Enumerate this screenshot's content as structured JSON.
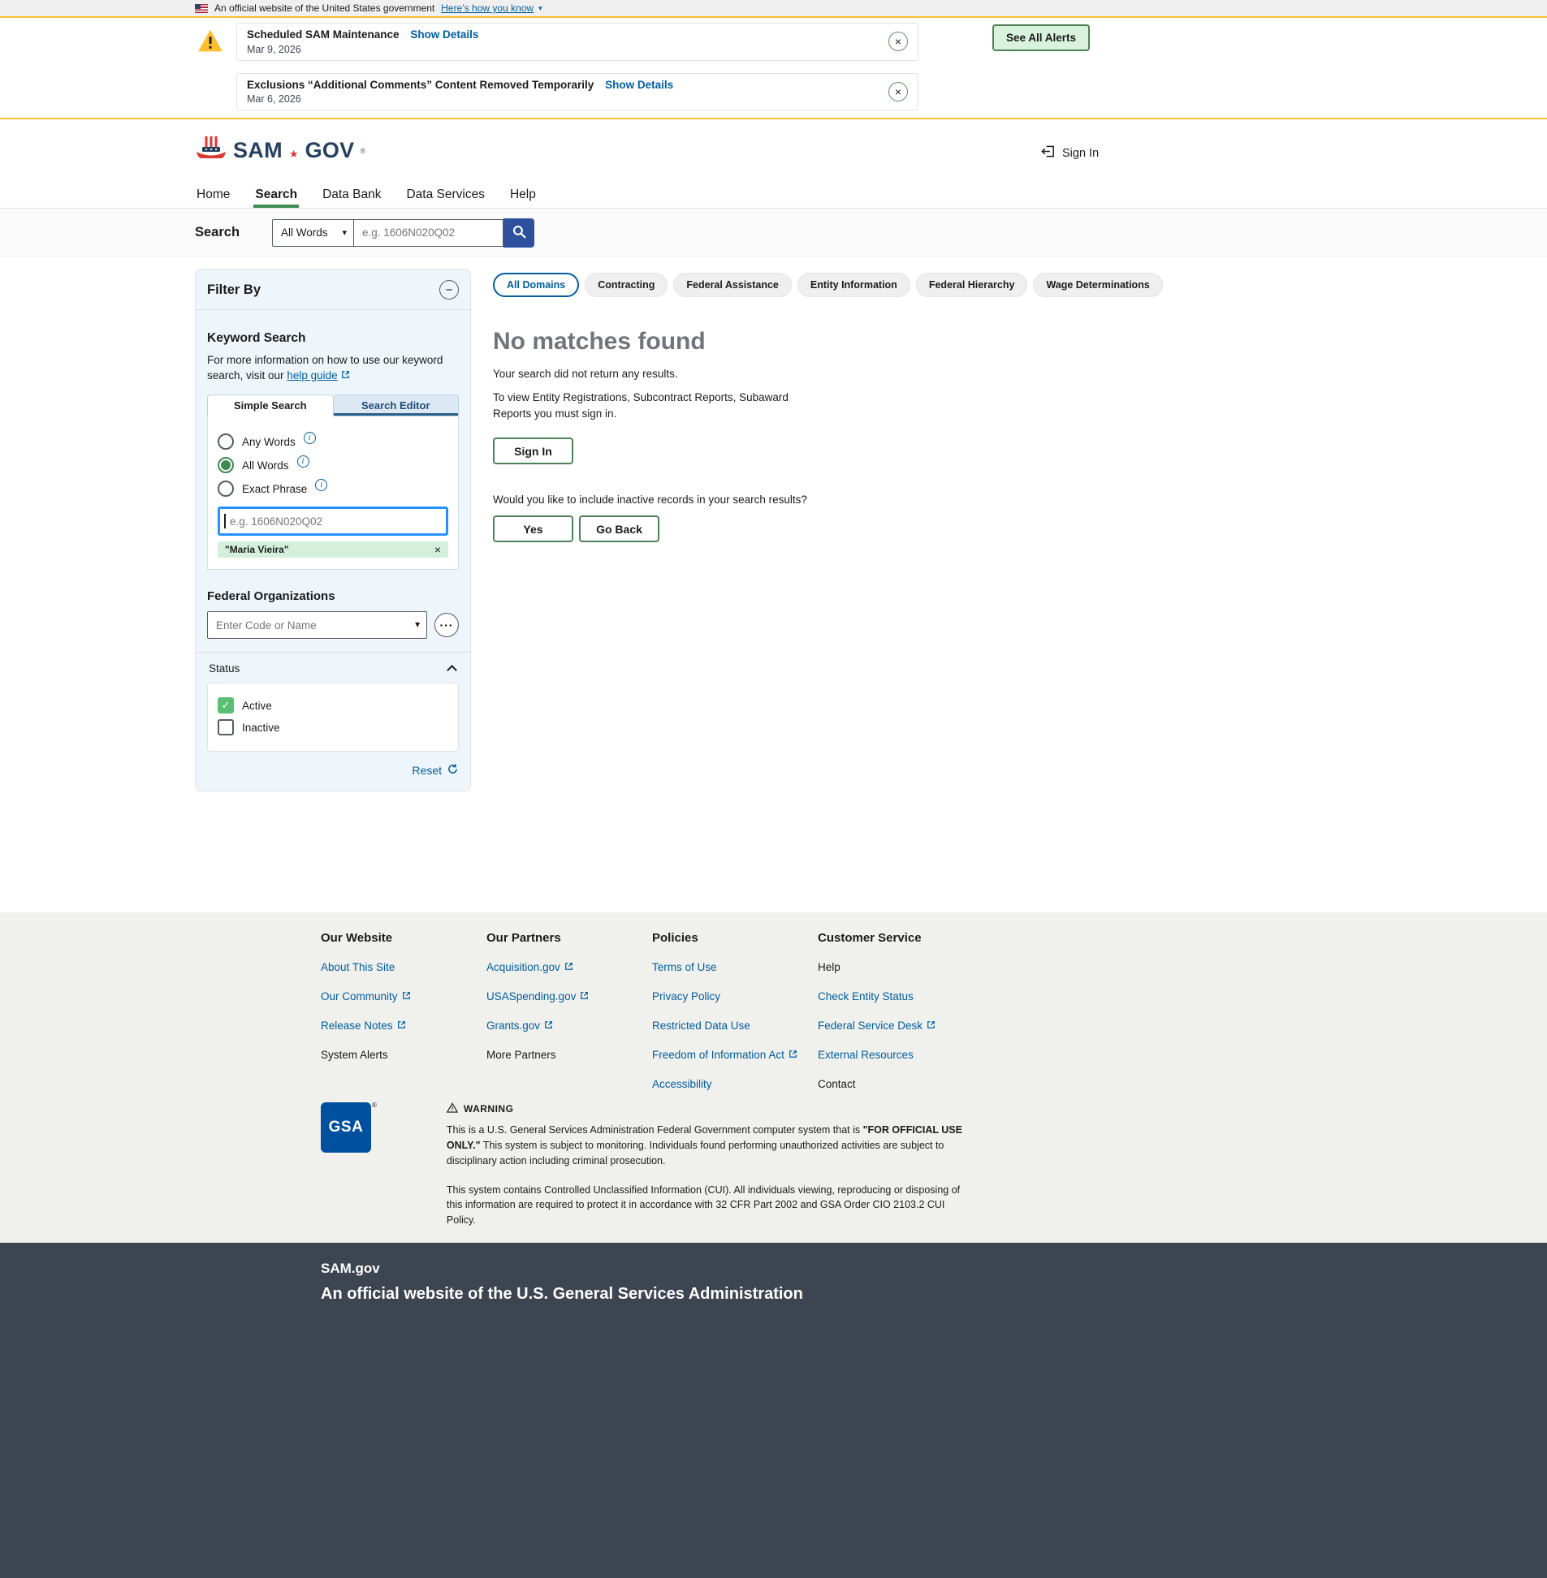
{
  "colors": {
    "accent_green": "#4d8055",
    "link_blue": "#005ea2",
    "search_button_blue": "#2e509f",
    "warning_yellow": "#ffbe2e",
    "focus_blue": "#2491ff",
    "dark_footer_bg": "#3d4551"
  },
  "icons": {
    "close": "×",
    "minus": "−",
    "ellipsis": "···",
    "caret_down": "▾",
    "check": "✓",
    "info": "i",
    "star": "★",
    "reg": "®"
  },
  "gov_banner": {
    "text": "An official website of the United States government",
    "link": "Here’s how you know"
  },
  "alerts": {
    "see_all_label": "See All Alerts",
    "items": [
      {
        "title": "Scheduled SAM Maintenance",
        "details_link": "Show Details",
        "date": "Mar 9, 2026"
      },
      {
        "title": "Exclusions “Additional Comments” Content Removed Temporarily",
        "details_link": "Show Details",
        "date": "Mar 6, 2026"
      }
    ]
  },
  "header": {
    "logo_sam": "SAM",
    "logo_gov": "GOV",
    "sign_in_label": "Sign In",
    "nav": [
      {
        "label": "Home"
      },
      {
        "label": "Search",
        "active": true
      },
      {
        "label": "Data Bank"
      },
      {
        "label": "Data Services"
      },
      {
        "label": "Help"
      }
    ]
  },
  "search_bar": {
    "label": "Search",
    "mode_selected": "All Words",
    "placeholder": "e.g. 1606N020Q02"
  },
  "filter": {
    "title": "Filter By",
    "keyword": {
      "heading": "Keyword Search",
      "help_text": "For more information on how to use our keyword search, visit our",
      "help_link": "help guide",
      "tabs": [
        "Simple Search",
        "Search Editor"
      ],
      "options": [
        "Any Words",
        "All Words",
        "Exact Phrase"
      ],
      "selected_option": "All Words",
      "input_placeholder": "e.g. 1606N020Q02",
      "chip": "\"Maria Vieira\""
    },
    "federal_orgs": {
      "heading": "Federal Organizations",
      "placeholder": "Enter Code or Name"
    },
    "status": {
      "heading": "Status",
      "options": [
        {
          "label": "Active",
          "checked": true
        },
        {
          "label": "Inactive",
          "checked": false
        }
      ]
    },
    "reset_label": "Reset"
  },
  "results": {
    "domains": [
      {
        "label": "All Domains",
        "active": true
      },
      {
        "label": "Contracting"
      },
      {
        "label": "Federal Assistance"
      },
      {
        "label": "Entity Information"
      },
      {
        "label": "Federal Hierarchy"
      },
      {
        "label": "Wage Determinations"
      }
    ],
    "no_matches_title": "No matches found",
    "no_results_text": "Your search did not return any results.",
    "sign_in_text": "To view Entity Registrations, Subcontract Reports, Subaward Reports you must sign in.",
    "sign_in_button": "Sign In",
    "inactive_question": "Would you like to include inactive records in your search results?",
    "yes_button": "Yes",
    "go_back_button": "Go Back"
  },
  "footer": {
    "columns": [
      {
        "heading": "Our Website",
        "links": [
          {
            "label": "About This Site"
          },
          {
            "label": "Our Community",
            "external": true
          },
          {
            "label": "Release Notes",
            "external": true
          },
          {
            "label": "System Alerts"
          }
        ]
      },
      {
        "heading": "Our Partners",
        "links": [
          {
            "label": "Acquisition.gov",
            "external": true
          },
          {
            "label": "USASpending.gov",
            "external": true
          },
          {
            "label": "Grants.gov",
            "external": true
          },
          {
            "label": "More Partners"
          }
        ]
      },
      {
        "heading": "Policies",
        "links": [
          {
            "label": "Terms of Use"
          },
          {
            "label": "Privacy Policy"
          },
          {
            "label": "Restricted Data Use"
          },
          {
            "label": "Freedom of Information Act",
            "external": true
          },
          {
            "label": "Accessibility"
          }
        ]
      },
      {
        "heading": "Customer Service",
        "links": [
          {
            "label": "Help"
          },
          {
            "label": "Check Entity Status"
          },
          {
            "label": "Federal Service Desk",
            "external": true
          },
          {
            "label": "External Resources"
          },
          {
            "label": "Contact"
          }
        ]
      }
    ],
    "gsa_label": "GSA",
    "warning_title": "WARNING",
    "warning_p1_a": "This is a U.S. General Services Administration Federal Government computer system that is ",
    "warning_p1_b": "\"FOR OFFICIAL USE ONLY.\"",
    "warning_p1_c": " This system is subject to monitoring. Individuals found performing unauthorized activities are subject to disciplinary action including criminal prosecution.",
    "warning_p2": "This system contains Controlled Unclassified Information (CUI). All individuals viewing, reproducing or disposing of this information are required to protect it in accordance with 32 CFR Part 2002 and GSA Order CIO 2103.2 CUI Policy.",
    "site_name": "SAM.gov",
    "official_line": "An official website of the U.S. General Services Administration"
  }
}
